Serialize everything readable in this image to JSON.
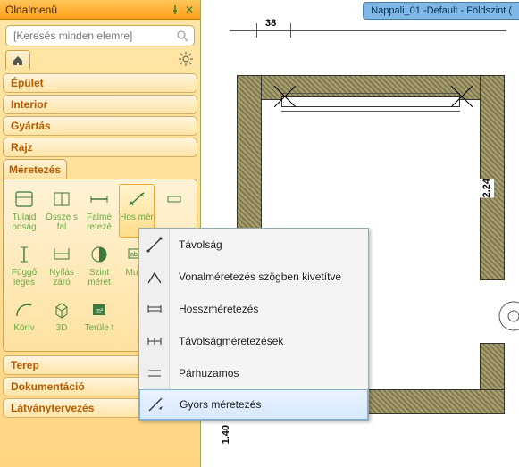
{
  "panel": {
    "title": "Oldalmenü",
    "search_placeholder": "[Keresés minden elemre]"
  },
  "categories": {
    "epulet": "Épület",
    "interior": "Interior",
    "gyartas": "Gyártás",
    "rajz": "Rajz",
    "meretezes": "Méretezés",
    "terep": "Terep",
    "dokumentacio": "Dokumentáció",
    "latvany": "Látványtervezés"
  },
  "tools": {
    "row1": [
      {
        "label": "Tulajd\nonság"
      },
      {
        "label": "Össze\ns fal"
      },
      {
        "label": "Falmé\nretezé"
      },
      {
        "label": "Hos\nmér"
      },
      {
        "label": ""
      }
    ],
    "row2": [
      {
        "label": "Függő\nleges"
      },
      {
        "label": "Nyílás\nzáró"
      },
      {
        "label": "Szint\nméret"
      },
      {
        "label": "Mut\nó"
      },
      {
        "label": ""
      }
    ],
    "row3": [
      {
        "label": "Körív"
      },
      {
        "label": "3D"
      },
      {
        "label": "Terüle\nt"
      },
      {
        "label": ""
      },
      {
        "label": ""
      }
    ]
  },
  "context_menu": {
    "items": [
      {
        "label": "Távolság"
      },
      {
        "label": "Vonalméretezés szögben kivetítve"
      },
      {
        "label": "Hosszméretezés"
      },
      {
        "label": "Távolságméretezések"
      },
      {
        "label": "Párhuzamos"
      },
      {
        "label": "Gyors méretezés"
      }
    ]
  },
  "document": {
    "tab": "Nappali_01 -Default - Földszint ("
  },
  "plan": {
    "dim_top": "38",
    "dim_right": "2.24",
    "dim_bottomleft": "1.40"
  }
}
